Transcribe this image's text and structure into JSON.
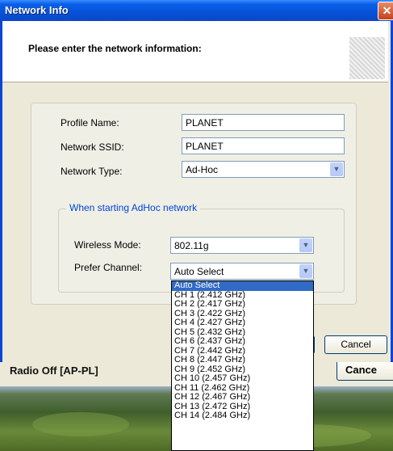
{
  "background": {
    "window_text": "Radio Off [AP-PL]",
    "cancel_label": "Cance"
  },
  "dialog": {
    "title": "Network Info",
    "close_glyph": "✕",
    "header_text": "Please enter the network information:",
    "profile_name_label": "Profile Name:",
    "profile_name_value": "PLANET",
    "ssid_label": "Network SSID:",
    "ssid_value": "PLANET",
    "network_type_label": "Network Type:",
    "network_type_value": "Ad-Hoc",
    "adhoc_group_title": "When starting AdHoc network",
    "wireless_mode_label": "Wireless Mode:",
    "wireless_mode_value": "802.11g",
    "prefer_channel_label": "Prefer Channel:",
    "prefer_channel_value": "Auto Select",
    "ok_label": "",
    "cancel_label": "Cancel"
  },
  "channel_options": [
    "Auto Select",
    "CH 1 (2.412 GHz)",
    "CH 2 (2.417 GHz)",
    "CH 3 (2.422 GHz)",
    "CH 4 (2.427 GHz)",
    "CH 5 (2.432 GHz)",
    "CH 6 (2.437 GHz)",
    "CH 7 (2.442 GHz)",
    "CH 8 (2.447 GHz)",
    "CH 9 (2.452 GHz)",
    "CH 10 (2.457 GHz)",
    "CH 11 (2.462 GHz)",
    "CH 12 (2.467 GHz)",
    "CH 13 (2.472 GHz)",
    "CH 14 (2.484 GHz)"
  ],
  "selected_channel_index": 0,
  "colors": {
    "title_bar": "#0a5fe8",
    "selection": "#316ac5",
    "group_title": "#0046d5"
  }
}
